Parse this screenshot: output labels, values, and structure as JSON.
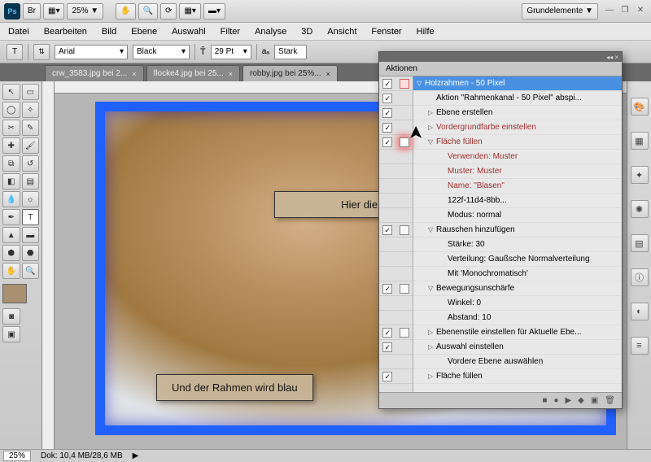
{
  "titlebar": {
    "app": "Ps",
    "br": "Br",
    "zoom_selector": "25% ▼",
    "workspace": "Grundelemente ▼"
  },
  "menu": [
    "Datei",
    "Bearbeiten",
    "Bild",
    "Ebene",
    "Auswahl",
    "Filter",
    "Analyse",
    "3D",
    "Ansicht",
    "Fenster",
    "Hilfe"
  ],
  "optbar": {
    "font": "Arial",
    "style": "Black",
    "size": "29 Pt",
    "aa": "Stark"
  },
  "tabs": [
    {
      "label": "crw_3583.jpg bei 2...",
      "active": false
    },
    {
      "label": "flocke4.jpg bei 25...",
      "active": false
    },
    {
      "label": "robby.jpg bei 25%...",
      "active": true
    }
  ],
  "annotations": {
    "dialog": "Hier die Dialogbox aktivieren",
    "frame": "Und der Rahmen wird blau"
  },
  "actions": {
    "title": "Aktionen",
    "items": [
      {
        "check": true,
        "dlg": "red",
        "indent": 0,
        "tri": "open",
        "text": "Holzrahmen - 50 Pixel",
        "hdr": true
      },
      {
        "check": true,
        "dlg": "none",
        "indent": 1,
        "tri": "",
        "text": "Aktion \"Rahmenkanal - 50 Pixel\" abspi..."
      },
      {
        "check": true,
        "dlg": "none",
        "indent": 1,
        "tri": "closed",
        "text": "Ebene erstellen"
      },
      {
        "check": true,
        "dlg": "none",
        "indent": 1,
        "tri": "closed",
        "text": "Vordergrundfarbe einstellen",
        "red": true
      },
      {
        "check": true,
        "dlg": "active",
        "indent": 1,
        "tri": "open",
        "text": "Fläche füllen",
        "red": true
      },
      {
        "check": null,
        "dlg": null,
        "indent": 2,
        "tri": "",
        "text": "Verwenden: Muster",
        "red": true
      },
      {
        "check": null,
        "dlg": null,
        "indent": 2,
        "tri": "",
        "text": "Muster: Muster",
        "red": true
      },
      {
        "check": null,
        "dlg": null,
        "indent": 2,
        "tri": "",
        "text": "Name: \"Blasen\"",
        "red": true
      },
      {
        "check": null,
        "dlg": null,
        "indent": 2,
        "tri": "",
        "text": "122f-11d4-8bb..."
      },
      {
        "check": null,
        "dlg": null,
        "indent": 2,
        "tri": "",
        "text": "Modus: normal"
      },
      {
        "check": true,
        "dlg": "plain",
        "indent": 1,
        "tri": "open",
        "text": "Rauschen hinzufügen"
      },
      {
        "check": null,
        "dlg": null,
        "indent": 2,
        "tri": "",
        "text": "Stärke: 30"
      },
      {
        "check": null,
        "dlg": null,
        "indent": 2,
        "tri": "",
        "text": "Verteilung: Gaußsche Normalverteilung"
      },
      {
        "check": null,
        "dlg": null,
        "indent": 2,
        "tri": "",
        "text": "Mit 'Monochromatisch'"
      },
      {
        "check": true,
        "dlg": "plain",
        "indent": 1,
        "tri": "open",
        "text": "Bewegungsunschärfe"
      },
      {
        "check": null,
        "dlg": null,
        "indent": 2,
        "tri": "",
        "text": "Winkel: 0"
      },
      {
        "check": null,
        "dlg": null,
        "indent": 2,
        "tri": "",
        "text": "Abstand: 10"
      },
      {
        "check": true,
        "dlg": "plain",
        "indent": 1,
        "tri": "closed",
        "text": "Ebenenstile einstellen für Aktuelle Ebe..."
      },
      {
        "check": true,
        "dlg": "none",
        "indent": 1,
        "tri": "closed",
        "text": "Auswahl einstellen"
      },
      {
        "check": null,
        "dlg": null,
        "indent": 2,
        "tri": "",
        "text": "Vordere Ebene auswählen"
      },
      {
        "check": true,
        "dlg": "none",
        "indent": 1,
        "tri": "closed",
        "text": "Fläche füllen"
      }
    ],
    "footer_icons": [
      "■",
      "●",
      "▶",
      "◆",
      "▣",
      "🗑"
    ]
  },
  "status": {
    "zoom": "25%",
    "doc": "Dok: 10,4 MB/28,6 MB"
  }
}
